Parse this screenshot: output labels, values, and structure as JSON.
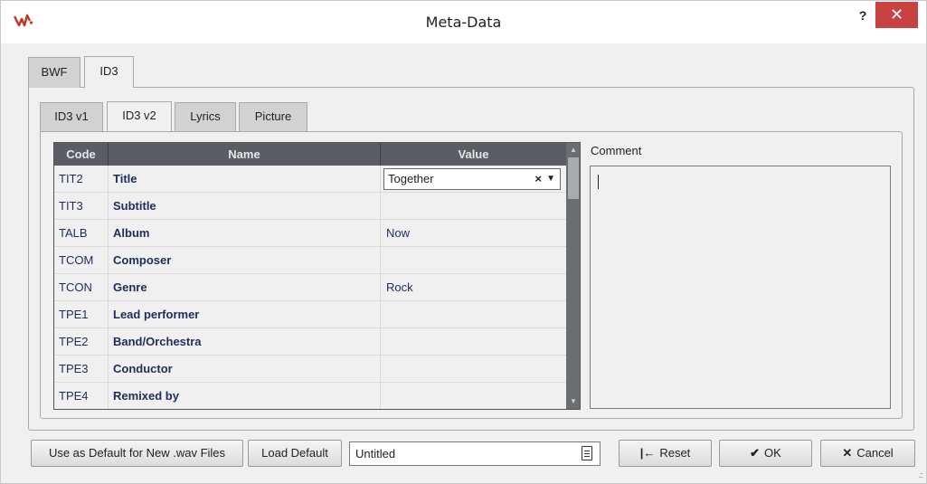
{
  "window": {
    "title": "Meta-Data",
    "help_label": "?",
    "close_label": "✕"
  },
  "outer_tabs": [
    "BWF",
    "ID3"
  ],
  "inner_tabs": [
    "ID3 v1",
    "ID3 v2",
    "Lyrics",
    "Picture"
  ],
  "table": {
    "headers": {
      "code": "Code",
      "name": "Name",
      "value": "Value"
    },
    "rows": [
      {
        "code": "TIT2",
        "name": "Title",
        "value": "Together"
      },
      {
        "code": "TIT3",
        "name": "Subtitle",
        "value": ""
      },
      {
        "code": "TALB",
        "name": "Album",
        "value": "Now"
      },
      {
        "code": "TCOM",
        "name": "Composer",
        "value": ""
      },
      {
        "code": "TCON",
        "name": "Genre",
        "value": "Rock"
      },
      {
        "code": "TPE1",
        "name": "Lead performer",
        "value": ""
      },
      {
        "code": "TPE2",
        "name": "Band/Orchestra",
        "value": ""
      },
      {
        "code": "TPE3",
        "name": "Conductor",
        "value": ""
      },
      {
        "code": "TPE4",
        "name": "Remixed by",
        "value": ""
      }
    ],
    "editor_clear": "×",
    "editor_arrow": "▼"
  },
  "comment": {
    "label": "Comment"
  },
  "footer": {
    "default_button": "Use as Default for New .wav Files",
    "load_default_button": "Load Default",
    "preset_value": "Untitled",
    "reset_icon": "|←",
    "reset_label": "Reset",
    "ok_icon": "✔",
    "ok_label": "OK",
    "cancel_icon": "✕",
    "cancel_label": "Cancel"
  },
  "colors": {
    "header": "#5a5d63",
    "close": "#c84242",
    "text_link": "#1f2d5b"
  },
  "icons": [
    "app-logo-icon",
    "help-icon",
    "close-icon",
    "dropdown-arrow-icon",
    "clear-icon",
    "preset-icon",
    "reset-icon",
    "checkmark-icon",
    "cancel-icon"
  ]
}
